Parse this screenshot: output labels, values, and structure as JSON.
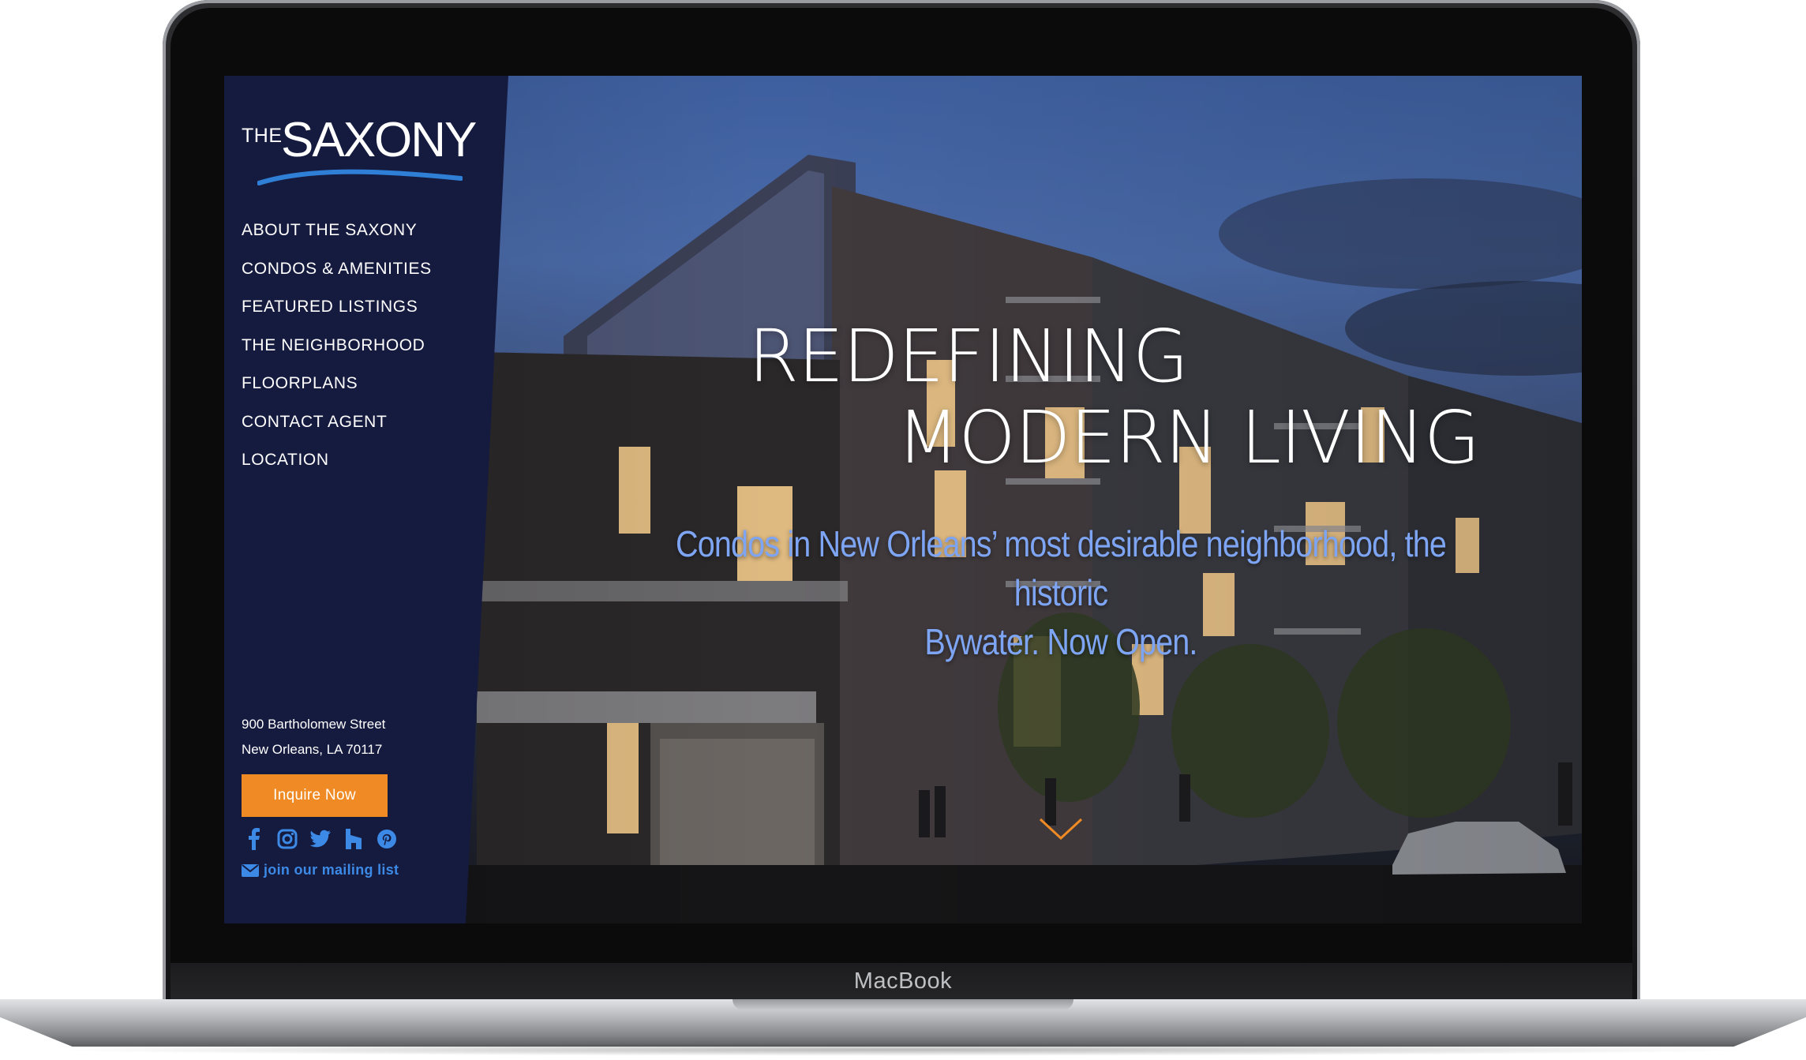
{
  "device": {
    "label": "MacBook"
  },
  "brand": {
    "the": "THE",
    "name": "SAXONY"
  },
  "nav": [
    {
      "label": "ABOUT THE SAXONY"
    },
    {
      "label": "CONDOS & AMENITIES"
    },
    {
      "label": "FEATURED LISTINGS"
    },
    {
      "label": "THE NEIGHBORHOOD"
    },
    {
      "label": "FLOORPLANS"
    },
    {
      "label": "CONTACT AGENT"
    },
    {
      "label": "LOCATION"
    }
  ],
  "address": {
    "line1": "900 Bartholomew Street",
    "line2": "New Orleans, LA 70117"
  },
  "cta": {
    "label": "Inquire Now"
  },
  "socials": [
    "facebook-icon",
    "instagram-icon",
    "twitter-icon",
    "houzz-icon",
    "pinterest-icon"
  ],
  "mailing": {
    "label": "join our mailing list"
  },
  "hero": {
    "headline_line1": "REDEFINING",
    "headline_line2": "MODERN LIVING",
    "subhead_line1": "Condos in New Orleans’ most desirable neighborhood, the historic",
    "subhead_line2": "Bywater. Now Open."
  },
  "colors": {
    "sidebar": "#151a3f",
    "accent_orange": "#f08a24",
    "link_blue": "#3c8ae6",
    "subhead_blue": "#7ea5f3"
  }
}
